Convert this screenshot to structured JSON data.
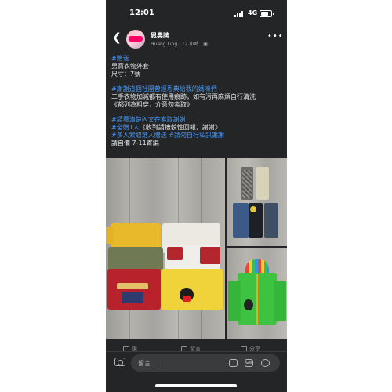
{
  "status_bar": {
    "time": "12:01",
    "network": "4G",
    "battery_level": 0.8
  },
  "post": {
    "page_name": "恩典牌",
    "author": "Huang Ling",
    "time_ago": "12 小時",
    "lines": [
      {
        "text": "#贈送",
        "tag": true
      },
      {
        "text": "男寶衣物外套",
        "tag": false
      },
      {
        "text": "尺寸：7號",
        "tag": false
      },
      {
        "text": "",
        "tag": false
      },
      {
        "text": "#謝謝這個社團曾經恩典給我的媽咪們",
        "tag": true
      },
      {
        "text": "二手衣物加減都有使用痕跡，如有污再麻煩自行清洗",
        "tag": false
      },
      {
        "text": "《都列為粗穿，介意勿索取》",
        "tag": false
      },
      {
        "text": "",
        "tag": false
      },
      {
        "text": "#請看清楚內文在索取謝謝",
        "tag": true
      },
      {
        "text_tag": "#全贈1人",
        "text": "《收到請禮貌性回報，謝謝》",
        "mixed": true
      },
      {
        "text": "#多人索取選人贈送 #請勿自行私訊謝謝",
        "tag": true
      },
      {
        "text": "請自備 7-11寄編",
        "tag": false
      }
    ]
  },
  "photos": {
    "main_alt": "children's t-shirts",
    "side_top_alt": "children's pants",
    "side_bottom_alt": "green hooded jacket"
  },
  "actions": {
    "like": "讚",
    "comment": "留言",
    "share": "分享"
  },
  "comment_bar": {
    "placeholder": "留言......",
    "gif_label": "GIF"
  },
  "colors": {
    "background": "#242526",
    "hashtag": "#4599ff",
    "text": "#e4e6eb"
  }
}
